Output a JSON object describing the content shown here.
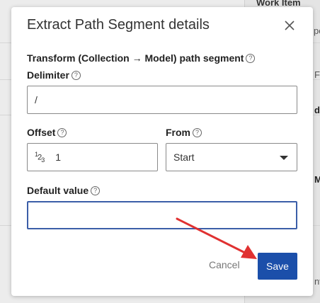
{
  "background": {
    "column_header": "Work Item",
    "fragments": [
      "pe",
      "F",
      "d",
      "M",
      "nv"
    ]
  },
  "dialog": {
    "title": "Extract Path Segment details",
    "section_label": "Transform (Collection → Model) path segment",
    "delimiter": {
      "label": "Delimiter",
      "value": "/"
    },
    "offset": {
      "label": "Offset",
      "icon_glyph": "123",
      "value": "1"
    },
    "from": {
      "label": "From",
      "selected": "Start"
    },
    "default_value": {
      "label": "Default value",
      "value": ""
    },
    "cancel_label": "Cancel",
    "save_label": "Save",
    "help_glyph": "?"
  },
  "colors": {
    "primary": "#1b4faa",
    "focus_border": "#3b5ea8",
    "annotation_arrow": "#e03131"
  }
}
